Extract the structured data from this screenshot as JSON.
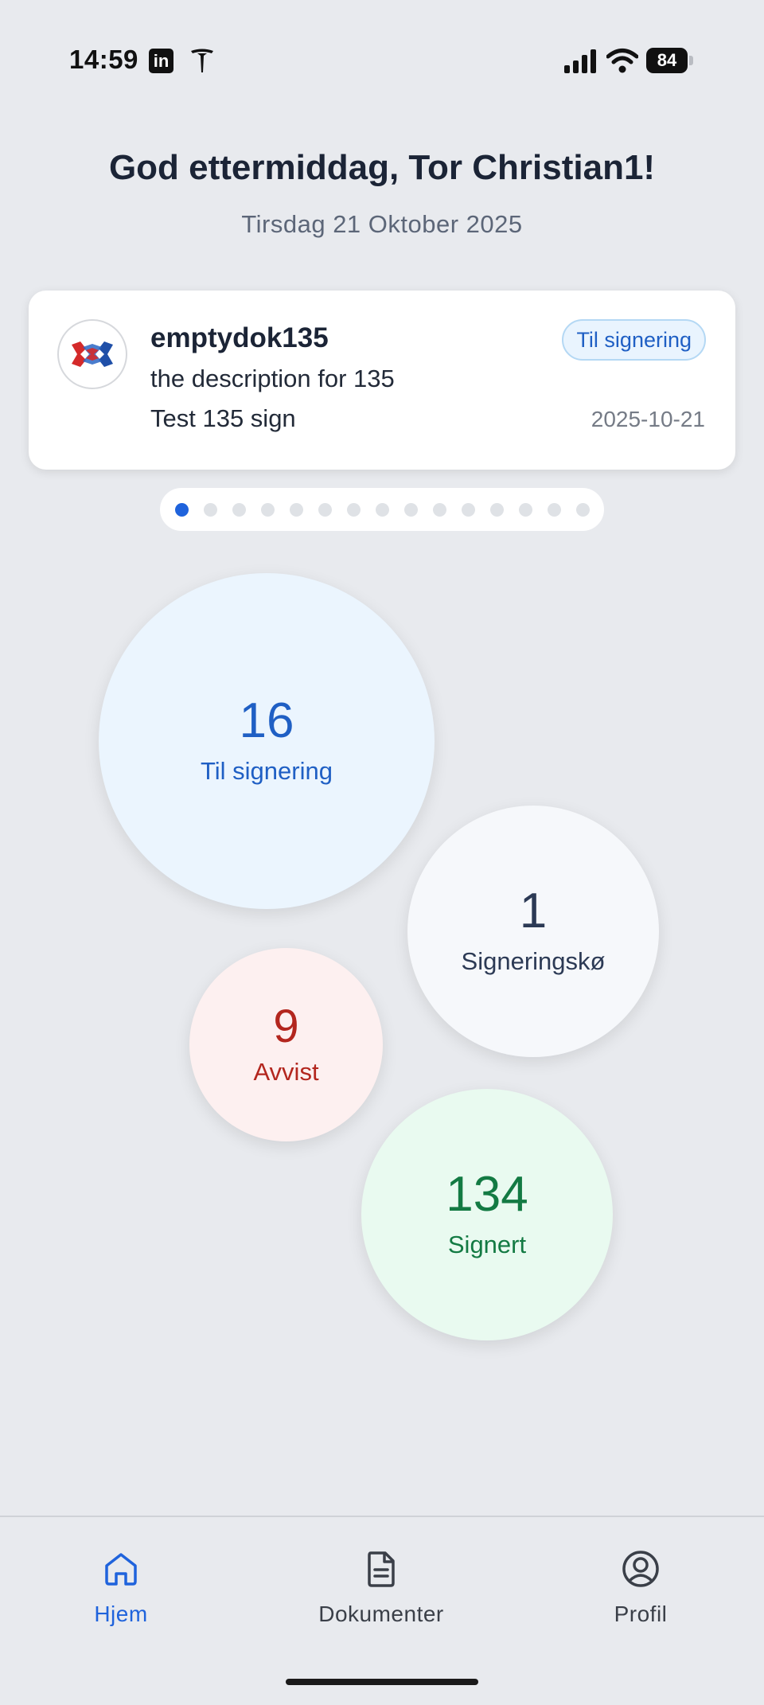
{
  "status_bar": {
    "time": "14:59",
    "battery_level": "84",
    "icons": [
      "linkedin-icon",
      "tesla-icon",
      "cellular-signal-icon",
      "wifi-icon",
      "battery-icon"
    ]
  },
  "header": {
    "greeting": "God ettermiddag, Tor Christian1!",
    "date": "Tirsdag 21 Oktober 2025"
  },
  "document_card": {
    "title": "emptydok135",
    "description": "the description for 135",
    "subtitle": "Test 135 sign",
    "status": "Til signering",
    "date": "2025-10-21",
    "colors": {
      "badge_bg": "#e9f4fe",
      "badge_text": "#1f5fc4"
    }
  },
  "pagination": {
    "total": 15,
    "active_index": 0
  },
  "stats": {
    "pending": {
      "count": "16",
      "label": "Til signering",
      "color": "#1f5fc4"
    },
    "queue": {
      "count": "1",
      "label": "Signeringskø",
      "color": "#2c3a55"
    },
    "rejected": {
      "count": "9",
      "label": "Avvist",
      "color": "#b3261e"
    },
    "signed": {
      "count": "134",
      "label": "Signert",
      "color": "#137a43"
    }
  },
  "nav": {
    "items": [
      {
        "label": "Hjem",
        "icon": "home-icon",
        "active": true
      },
      {
        "label": "Dokumenter",
        "icon": "document-icon",
        "active": false
      },
      {
        "label": "Profil",
        "icon": "profile-icon",
        "active": false
      }
    ],
    "accent": "#1f63dc"
  }
}
